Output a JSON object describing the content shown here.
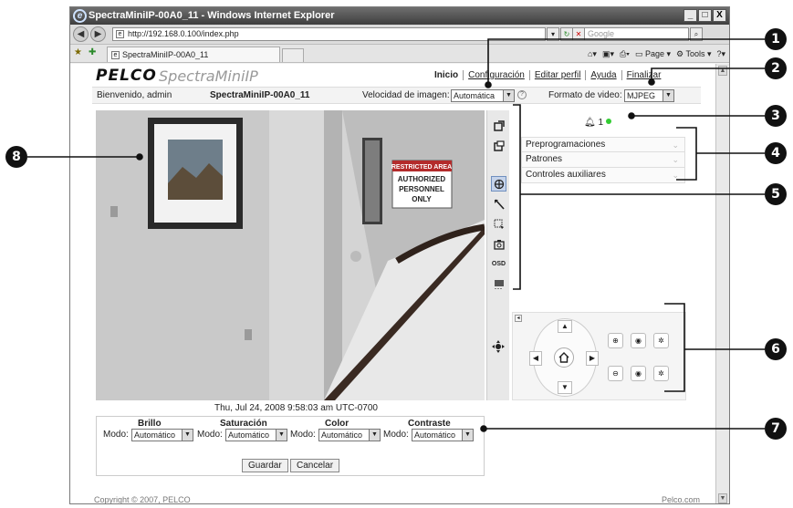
{
  "window": {
    "title": "SpectraMiniIP-00A0_11 - Windows Internet Explorer",
    "url": "http://192.168.0.100/index.php",
    "search_placeholder": "Google",
    "tab_label": "SpectraMiniIP-00A0_11",
    "cmd_page": "Page ▾",
    "cmd_tools": "Tools ▾",
    "min": "_",
    "max": "□",
    "close": "X"
  },
  "header": {
    "brand": "PELCO",
    "product": "SpectraMiniIP",
    "nav": [
      "Inicio",
      "Configuración",
      "Editar perfil",
      "Ayuda",
      "Finalizar"
    ]
  },
  "info": {
    "welcome": "Bienvenido, admin",
    "camera": "SpectraMiniIP-00A0_11",
    "rate_label": "Velocidad de imagen:",
    "rate_value": "Automática",
    "format_label": "Formato de video:",
    "format_value": "MJPEG"
  },
  "video": {
    "sign_lines": [
      "RESTRICTED AREA",
      "AUTHORIZED",
      "PERSONNEL",
      "ONLY"
    ],
    "timestamp": "Thu, Jul 24, 2008 9:58:03 am UTC-0700"
  },
  "alarm": {
    "count": "1"
  },
  "accordion": [
    "Preprogramaciones",
    "Patrones",
    "Controles auxiliares"
  ],
  "toolbar": {
    "osd": "OSD"
  },
  "settings": {
    "columns": [
      {
        "title": "Brillo",
        "mode_label": "Modo:",
        "value": "Automático"
      },
      {
        "title": "Saturación",
        "mode_label": "Modo:",
        "value": "Automático"
      },
      {
        "title": "Color",
        "mode_label": "Modo:",
        "value": "Automático"
      },
      {
        "title": "Contraste",
        "mode_label": "Modo:",
        "value": "Automático"
      }
    ],
    "save": "Guardar",
    "cancel": "Cancelar"
  },
  "footer": {
    "copyright": "Copyright © 2007, PELCO",
    "link": "Pelco.com"
  },
  "callouts": [
    "1",
    "2",
    "3",
    "4",
    "5",
    "6",
    "7",
    "8"
  ]
}
